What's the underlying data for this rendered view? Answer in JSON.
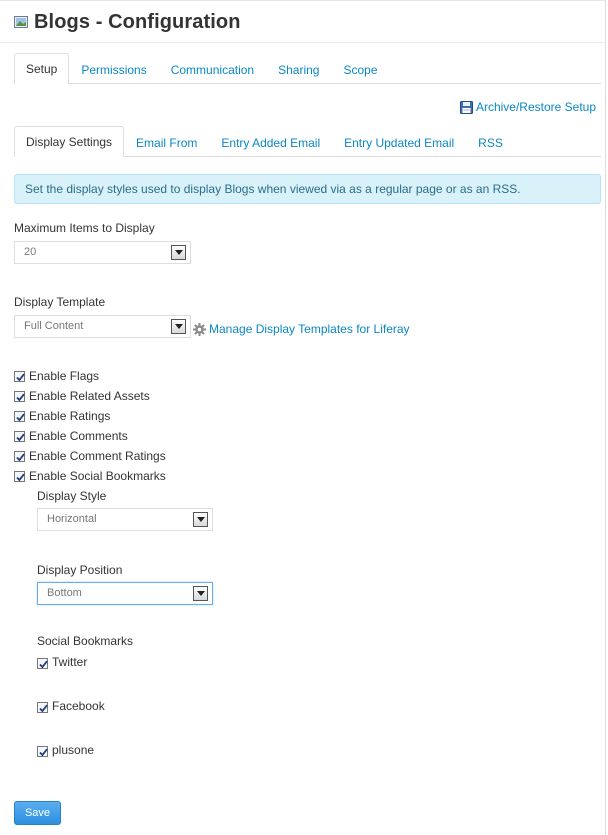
{
  "header": {
    "title": "Blogs - Configuration"
  },
  "tabs_top": [
    {
      "label": "Setup",
      "active": true
    },
    {
      "label": "Permissions"
    },
    {
      "label": "Communication"
    },
    {
      "label": "Sharing"
    },
    {
      "label": "Scope"
    }
  ],
  "archive_link": "Archive/Restore Setup",
  "tabs_sub": [
    {
      "label": "Display Settings",
      "active": true
    },
    {
      "label": "Email From"
    },
    {
      "label": "Entry Added Email"
    },
    {
      "label": "Entry Updated Email"
    },
    {
      "label": "RSS"
    }
  ],
  "info_message": "Set the display styles used to display Blogs when viewed via as a regular page or as an RSS.",
  "max_items": {
    "label": "Maximum Items to Display",
    "value": "20"
  },
  "display_template": {
    "label": "Display Template",
    "value": "Full Content",
    "manage_link": "Manage Display Templates for Liferay"
  },
  "checkboxes": [
    {
      "label": "Enable Flags",
      "checked": true
    },
    {
      "label": "Enable Related Assets",
      "checked": true
    },
    {
      "label": "Enable Ratings",
      "checked": true
    },
    {
      "label": "Enable Comments",
      "checked": true
    },
    {
      "label": "Enable Comment Ratings",
      "checked": true
    },
    {
      "label": "Enable Social Bookmarks",
      "checked": true
    }
  ],
  "display_style": {
    "label": "Display Style",
    "value": "Horizontal"
  },
  "display_position": {
    "label": "Display Position",
    "value": "Bottom"
  },
  "social_bookmarks": {
    "label": "Social Bookmarks",
    "items": [
      {
        "label": "Twitter",
        "checked": true
      },
      {
        "label": "Facebook",
        "checked": true
      },
      {
        "label": "plusone",
        "checked": true
      }
    ]
  },
  "save_label": "Save",
  "colors": {
    "link": "#0a88c4",
    "info_bg": "#d9f1f8",
    "save_bg": "#3a9be6"
  }
}
